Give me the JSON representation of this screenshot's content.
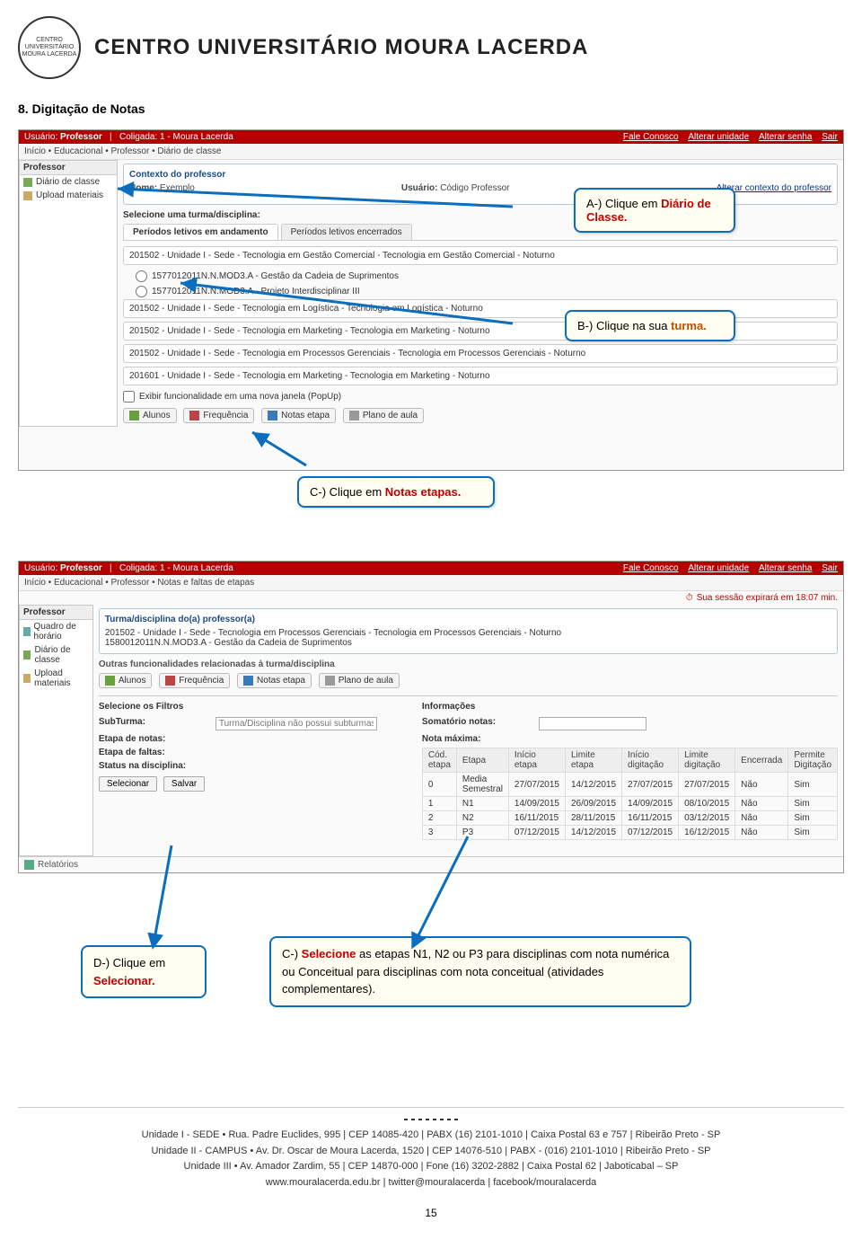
{
  "header": {
    "org_name": "CENTRO UNIVERSITÁRIO MOURA LACERDA",
    "seal_text": "CENTRO UNIVERSITÁRIO MOURA LACERDA"
  },
  "section_heading": "8. Digitação de Notas",
  "screenshot1": {
    "redbar_left_label": "Usuário:",
    "redbar_user": "Professor",
    "redbar_coligada_label": "Coligada:",
    "redbar_coligada": "1 - Moura Lacerda",
    "redbar_links": [
      "Fale Conosco",
      "Alterar unidade",
      "Alterar senha",
      "Sair"
    ],
    "crumb": "Início • Educacional • Professor • Diário de classe",
    "sidebar": {
      "title": "Professor",
      "items": [
        "Diário de classe",
        "Upload materiais"
      ]
    },
    "context_title": "Contexto do professor",
    "top_usuario_label": "Usuário:",
    "top_usuario_value": "Código Professor",
    "top_nome_label": "Nome:",
    "top_nome_value": "Exemplo",
    "top_link": "Alterar contexto do professor",
    "selecione_label": "Selecione uma turma/disciplina:",
    "tabs": [
      "Períodos letivos em andamento",
      "Períodos letivos encerrados"
    ],
    "groups": [
      "201502 - Unidade I - Sede - Tecnologia em Gestão Comercial - Tecnologia em Gestão Comercial - Noturno",
      "201502 - Unidade I - Sede - Tecnologia em Logística - Tecnologia em Logística - Noturno",
      "201502 - Unidade I - Sede - Tecnologia em Marketing - Tecnologia em Marketing - Noturno",
      "201502 - Unidade I - Sede - Tecnologia em Processos Gerenciais - Tecnologia em Processos Gerenciais - Noturno",
      "201601 - Unidade I - Sede - Tecnologia em Marketing - Tecnologia em Marketing - Noturno"
    ],
    "radio_items": [
      "1577012011N.N.MOD3.A - Gestão da Cadeia de Suprimentos",
      "1577012011N.N.MOD3.A - Projeto Interdisciplinar III"
    ],
    "checkbox_label": "Exibir funcionalidade em uma nova janela (PopUp)",
    "buttons": [
      "Alunos",
      "Frequência",
      "Notas etapa",
      "Plano de aula"
    ]
  },
  "callouts1": {
    "a_prefix": "A-) Clique em ",
    "a_kw": "Diário de Classe.",
    "b_prefix": "B-) Clique na sua ",
    "b_kw": "turma.",
    "c_prefix": "C-) Clique em ",
    "c_kw": "Notas etapas."
  },
  "screenshot2": {
    "redbar_left_label": "Usuário:",
    "redbar_user": "Professor",
    "redbar_coligada_label": "Coligada:",
    "redbar_coligada": "1 - Moura Lacerda",
    "redbar_links": [
      "Fale Conosco",
      "Alterar unidade",
      "Alterar senha",
      "Sair"
    ],
    "crumb": "Início • Educacional • Professor • Notas e faltas de etapas",
    "session_text": "Sua sessão expirará em 18:07 min.",
    "sidebar": {
      "title": "Professor",
      "items": [
        "Quadro de horário",
        "Diário de classe",
        "Upload materiais"
      ]
    },
    "turma_title": "Turma/disciplina do(a) professor(a)",
    "turma_line1": "201502 - Unidade I - Sede - Tecnologia em Processos Gerenciais - Tecnologia em Processos Gerenciais - Noturno",
    "turma_line2": "1580012011N.N.MOD3.A - Gestão da Cadeia de Suprimentos",
    "outras_title": "Outras funcionalidades relacionadas à turma/disciplina",
    "buttons": [
      "Alunos",
      "Frequência",
      "Notas etapa",
      "Plano de aula"
    ],
    "filtros_title": "Selecione os Filtros",
    "info_title": "Informações",
    "subturma_label": "SubTurma:",
    "subturma_placeholder": "Turma/Disciplina não possui subturmas",
    "somatorio_label": "Somatório notas:",
    "etapa_notas_label": "Etapa de notas:",
    "notamax_label": "Nota máxima:",
    "etapa_faltas_label": "Etapa de faltas:",
    "status_label": "Status na disciplina:",
    "action_buttons": [
      "Selecionar",
      "Salvar"
    ],
    "table_headers": [
      "Cód. etapa",
      "Etapa",
      "Início etapa",
      "Limite etapa",
      "Início digitação",
      "Limite digitação",
      "Encerrada",
      "Permite Digitação"
    ],
    "table_rows": [
      [
        "0",
        "Media Semestral",
        "27/07/2015",
        "14/12/2015",
        "27/07/2015",
        "27/07/2015",
        "Não",
        "Sim"
      ],
      [
        "1",
        "N1",
        "14/09/2015",
        "26/09/2015",
        "14/09/2015",
        "08/10/2015",
        "Não",
        "Sim"
      ],
      [
        "2",
        "N2",
        "16/11/2015",
        "28/11/2015",
        "16/11/2015",
        "03/12/2015",
        "Não",
        "Sim"
      ],
      [
        "3",
        "P3",
        "07/12/2015",
        "14/12/2015",
        "07/12/2015",
        "16/12/2015",
        "Não",
        "Sim"
      ]
    ],
    "relatorios": "Relatórios"
  },
  "callouts2": {
    "d_prefix": "D-) Clique em ",
    "d_kw": "Selecionar.",
    "c2_line1a": "C-) ",
    "c2_line1b": "Selecione",
    "c2_line1c": " as etapas N1, N2 ou P3 para disciplinas com nota numérica ou Conceitual para disciplinas com nota conceitual (atividades complementares)."
  },
  "footer": {
    "line1": "Unidade I - SEDE • Rua. Padre Euclides, 995  |  CEP 14085-420  |  PABX (16) 2101-1010  |  Caixa Postal 63 e 757  |  Ribeirão Preto - SP",
    "line2": "Unidade II - CAMPUS • Av. Dr. Oscar de Moura Lacerda, 1520  |  CEP 14076-510  |  PABX - (016) 2101-1010  |  Ribeirão Preto - SP",
    "line3": "Unidade III • Av. Amador Zardim, 55  |  CEP 14870-000  |  Fone (16) 3202-2882  |  Caixa Postal 62  |  Jaboticabal – SP",
    "line4": "www.mouralacerda.edu.br  |  twitter@mouralacerda  |  facebook/mouralacerda"
  },
  "page_number": "15"
}
